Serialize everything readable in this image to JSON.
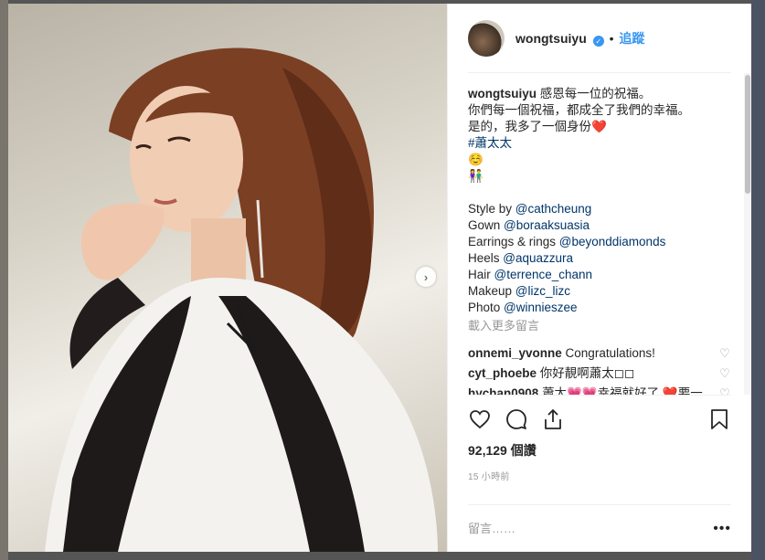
{
  "post": {
    "username": "wongtsuiyu",
    "verified_mark": "✓",
    "dot": "•",
    "follow_label": "追蹤",
    "next_arrow": "›"
  },
  "caption": {
    "username": "wongtsuiyu",
    "line1": "感恩每一位的祝福。",
    "line2": "你們每一個祝福，都成全了我們的幸福。",
    "line3": "是的，我多了一個身份❤️",
    "hashtag": "#蕭太太",
    "emoji1": "☺️",
    "emoji2": "👫",
    "credits": [
      {
        "label": "Style by ",
        "handle": "@cathcheung"
      },
      {
        "label": "Gown ",
        "handle": "@boraaksuasia"
      },
      {
        "label": "Earrings & rings ",
        "handle": "@beyonddiamonds"
      },
      {
        "label": "Heels ",
        "handle": "@aquazzura"
      },
      {
        "label": "Hair ",
        "handle": "@terrence_chann"
      },
      {
        "label": "Makeup ",
        "handle": "@lizc_lizc"
      },
      {
        "label": "Photo ",
        "handle": "@winnieszee"
      }
    ]
  },
  "load_more_label": "載入更多留言",
  "comments": [
    {
      "user": "onnemi_yvonne",
      "text": "Congratulations!"
    },
    {
      "user": "cyt_phoebe",
      "text": "你好靚啊蕭太◻◻"
    },
    {
      "user": "hychan0908",
      "text": "蕭太💗💗幸福就好了 ❤️要一直幸福下去💙🐠❤️"
    }
  ],
  "stats": {
    "likes": "92,129 個讚",
    "time": "15 小時前"
  },
  "add_comment": {
    "placeholder": "留言……",
    "more": "•••"
  },
  "icons": {
    "like": "heart-icon",
    "comment": "comment-icon",
    "share": "share-icon",
    "save": "bookmark-icon",
    "comment_like": "heart-outline-icon"
  },
  "colors": {
    "link": "#003569",
    "follow": "#3897f0",
    "muted": "#999999"
  }
}
